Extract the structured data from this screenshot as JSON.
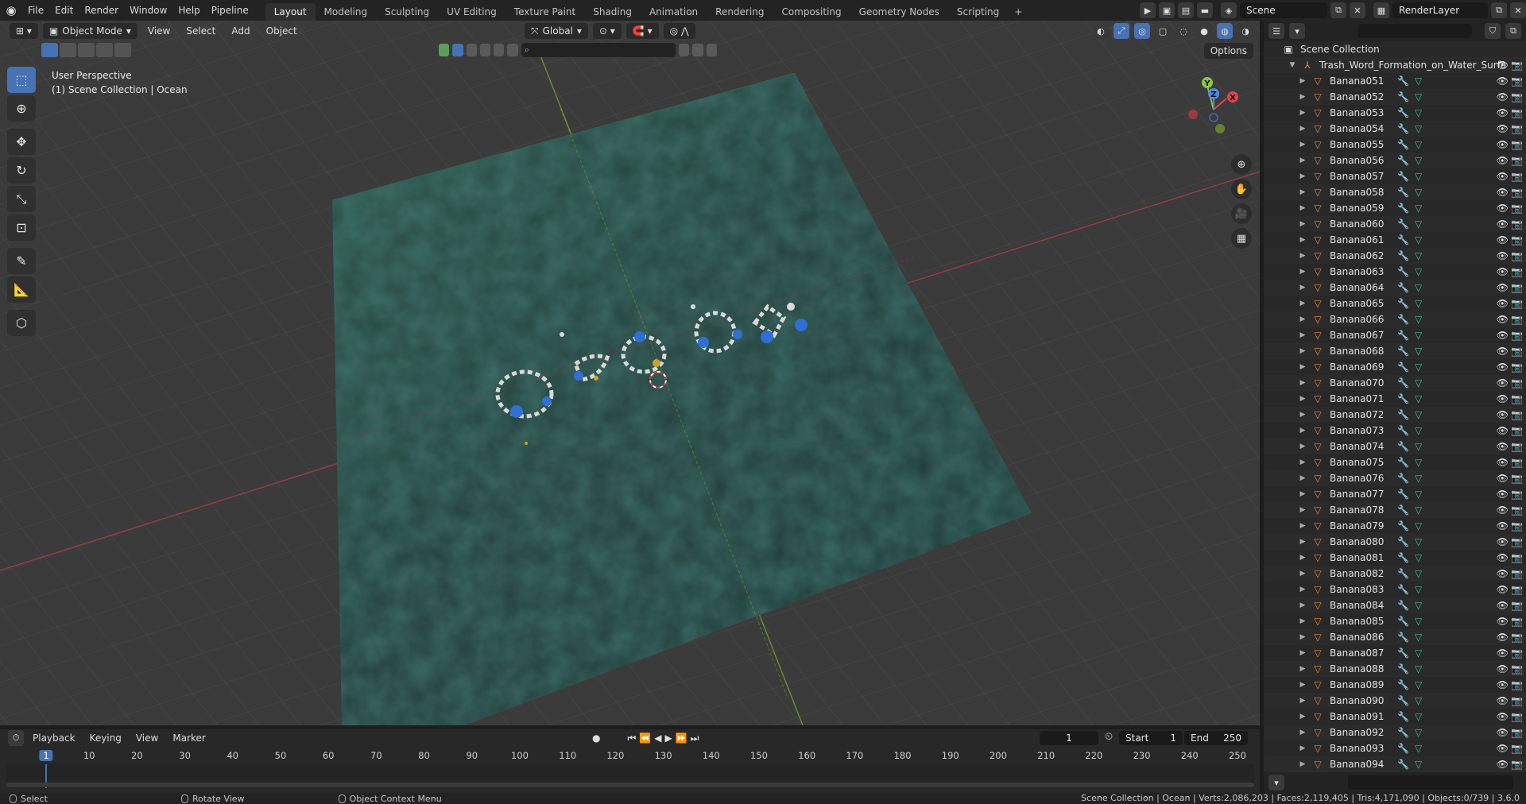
{
  "menu": {
    "items": [
      "File",
      "Edit",
      "Render",
      "Window",
      "Help",
      "Pipeline"
    ],
    "workspaces": [
      "Layout",
      "Modeling",
      "Sculpting",
      "UV Editing",
      "Texture Paint",
      "Shading",
      "Animation",
      "Rendering",
      "Compositing",
      "Geometry Nodes",
      "Scripting"
    ],
    "active_workspace": "Layout",
    "add_symbol": "+"
  },
  "top_right": {
    "scene": "Scene",
    "render_layer": "RenderLayer"
  },
  "viewport": {
    "mode": "Object Mode",
    "menus": [
      "View",
      "Select",
      "Add",
      "Object"
    ],
    "transform_orientation": "Global",
    "options_label": "Options",
    "info_line1": "User Perspective",
    "info_line2": "(1) Scene Collection | Ocean",
    "gizmo": {
      "x": "X",
      "y": "Y",
      "z": "Z"
    }
  },
  "outliner": {
    "scene_collection": "Scene Collection",
    "collection": "Trash_Word_Formation_on_Water_Surfa",
    "objects": [
      "Banana051",
      "Banana052",
      "Banana053",
      "Banana054",
      "Banana055",
      "Banana056",
      "Banana057",
      "Banana058",
      "Banana059",
      "Banana060",
      "Banana061",
      "Banana062",
      "Banana063",
      "Banana064",
      "Banana065",
      "Banana066",
      "Banana067",
      "Banana068",
      "Banana069",
      "Banana070",
      "Banana071",
      "Banana072",
      "Banana073",
      "Banana074",
      "Banana075",
      "Banana076",
      "Banana077",
      "Banana078",
      "Banana079",
      "Banana080",
      "Banana081",
      "Banana082",
      "Banana083",
      "Banana084",
      "Banana085",
      "Banana086",
      "Banana087",
      "Banana088",
      "Banana089",
      "Banana090",
      "Banana091",
      "Banana092",
      "Banana093",
      "Banana094"
    ]
  },
  "timeline": {
    "menus": [
      "Playback",
      "Keying",
      "View",
      "Marker"
    ],
    "current_frame": "1",
    "start_label": "Start",
    "start_value": "1",
    "end_label": "End",
    "end_value": "250",
    "ruler": [
      "1",
      "10",
      "20",
      "30",
      "40",
      "50",
      "60",
      "70",
      "80",
      "90",
      "100",
      "110",
      "120",
      "130",
      "140",
      "150",
      "160",
      "170",
      "180",
      "190",
      "200",
      "210",
      "220",
      "230",
      "240",
      "250"
    ]
  },
  "statusbar": {
    "select": "Select",
    "rotate": "Rotate View",
    "context": "Object Context Menu",
    "stats": "Scene Collection | Ocean | Verts:2,086,203 | Faces:2,119,405 | Tris:4,171,090 | Objects:0/739 | 3.6.0"
  }
}
